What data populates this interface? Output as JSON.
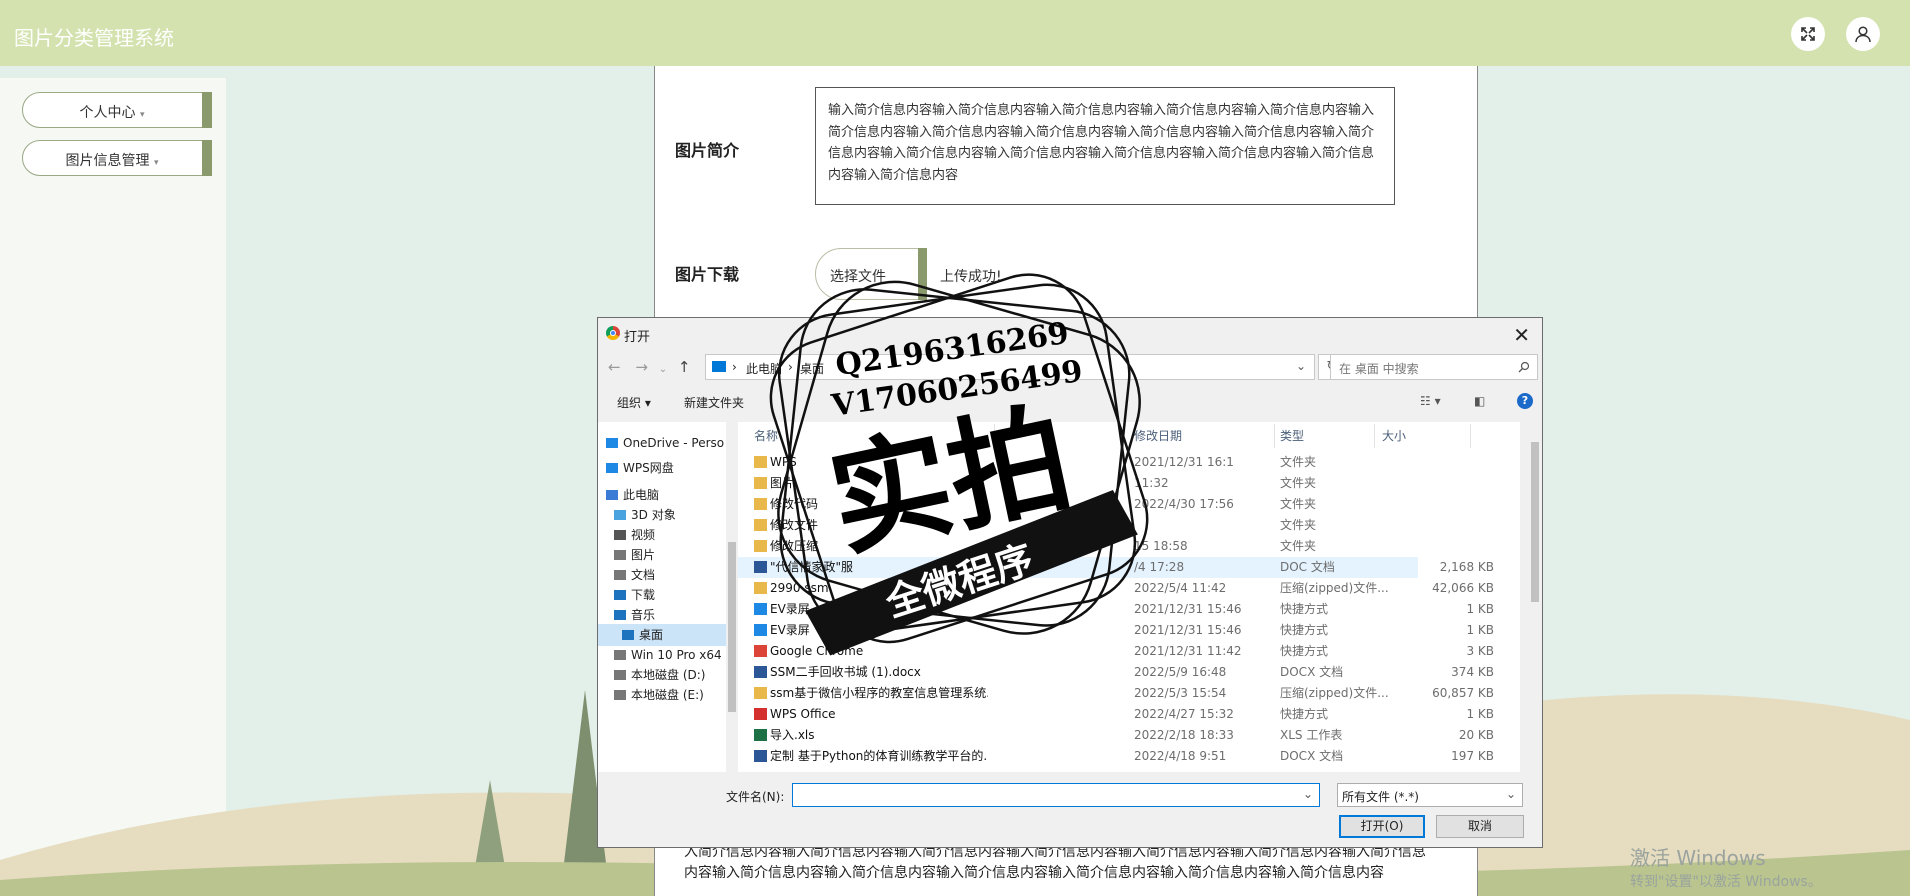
{
  "app": {
    "title": "图片分类管理系统"
  },
  "sidebar": {
    "items": [
      {
        "label": "个人中心"
      },
      {
        "label": "图片信息管理"
      }
    ]
  },
  "form": {
    "intro_label": "图片简介",
    "intro_text": "输入简介信息内容输入简介信息内容输入简介信息内容输入简介信息内容输入简介信息内容输入简介信息内容输入简介信息内容输入简介信息内容输入简介信息内容输入简介信息内容输入简介信息内容输入简介信息内容输入简介信息内容输入简介信息内容输入简介信息内容输入简介信息内容输入简介信息内容",
    "download_label": "图片下载",
    "choose_file": "选择文件",
    "upload_status": "上传成功!",
    "bottom_text": "入简介信息内容输入简介信息内容输入简介信息内容输入简介信息内容输入简介信息内容输入简介信息内容输入简介信息内容输入简介信息内容输入简介信息内容输入简介信息内容输入简介信息内容输入简介信息内容输入简介信息内容"
  },
  "watermark": {
    "line1": "激活 Windows",
    "line2": "转到\"设置\"以激活 Windows。"
  },
  "dialog": {
    "title": "打开",
    "address": {
      "crumbs": [
        "此电脑",
        "桌面"
      ]
    },
    "search_placeholder": "在 桌面 中搜索",
    "toolbar": {
      "organize": "组织 ▾",
      "new_folder": "新建文件夹"
    },
    "nav": [
      {
        "label": "OneDrive - Perso",
        "icon": "cloud-icon",
        "color": "#1e88e5"
      },
      {
        "label": "WPS网盘",
        "icon": "cloud-icon",
        "color": "#1e88e5"
      },
      {
        "label": "此电脑",
        "icon": "computer-icon",
        "color": "#3a7bd5"
      },
      {
        "label": "3D 对象",
        "icon": "cube-icon",
        "color": "#4aa3df"
      },
      {
        "label": "视频",
        "icon": "video-icon",
        "color": "#555555"
      },
      {
        "label": "图片",
        "icon": "picture-icon",
        "color": "#777777"
      },
      {
        "label": "文档",
        "icon": "document-icon",
        "color": "#777777"
      },
      {
        "label": "下载",
        "icon": "download-icon",
        "color": "#1e73be"
      },
      {
        "label": "音乐",
        "icon": "music-icon",
        "color": "#1e73be"
      },
      {
        "label": "桌面",
        "icon": "desktop-icon",
        "color": "#1e73be",
        "selected": true
      },
      {
        "label": "Win 10 Pro x64",
        "icon": "drive-icon",
        "color": "#777777"
      },
      {
        "label": "本地磁盘 (D:)",
        "icon": "drive-icon",
        "color": "#777777"
      },
      {
        "label": "本地磁盘 (E:)",
        "icon": "drive-icon",
        "color": "#777777"
      }
    ],
    "columns": [
      "名称",
      "修改日期",
      "类型",
      "大小"
    ],
    "files": [
      {
        "name": "WPS",
        "date": "2021/12/31 16:1",
        "type": "文件夹",
        "size": "",
        "icon": "folder-icon",
        "color": "#e8b84a"
      },
      {
        "name": "图片",
        "date": "11:32",
        "type": "文件夹",
        "size": "",
        "icon": "folder-icon",
        "color": "#e8b84a"
      },
      {
        "name": "修改代码",
        "date": "2022/4/30 17:56",
        "type": "文件夹",
        "size": "",
        "icon": "folder-icon",
        "color": "#e8b84a"
      },
      {
        "name": "修改文件",
        "date": "",
        "type": "文件夹",
        "size": "",
        "icon": "folder-icon",
        "color": "#e8b84a"
      },
      {
        "name": "修改压缩",
        "date": "15 18:58",
        "type": "文件夹",
        "size": "",
        "icon": "folder-icon",
        "color": "#e8b84a"
      },
      {
        "name": "\"代信情家政\"服",
        "date": "/4 17:28",
        "type": "DOC 文档",
        "size": "2,168 KB",
        "icon": "doc-icon",
        "color": "#2b5797",
        "highlight": true
      },
      {
        "name": "2990 ssm",
        "date": "2022/5/4 11:42",
        "type": "压缩(zipped)文件...",
        "size": "42,066 KB",
        "icon": "zip-icon",
        "color": "#e8b84a"
      },
      {
        "name": "EV录屏",
        "date": "2021/12/31 15:46",
        "type": "快捷方式",
        "size": "1 KB",
        "icon": "shortcut-icon",
        "color": "#1e88e5"
      },
      {
        "name": "EV录屏",
        "date": "2021/12/31 15:46",
        "type": "快捷方式",
        "size": "1 KB",
        "icon": "shortcut-icon",
        "color": "#1e88e5"
      },
      {
        "name": "Google Chrome",
        "date": "2021/12/31 11:42",
        "type": "快捷方式",
        "size": "3 KB",
        "icon": "chrome-icon",
        "color": "#db4437"
      },
      {
        "name": "SSM二手回收书城 (1).docx",
        "date": "2022/5/9 16:48",
        "type": "DOCX 文档",
        "size": "374 KB",
        "icon": "doc-icon",
        "color": "#2b5797"
      },
      {
        "name": "ssm基于微信小程序的教室信息管理系统...",
        "date": "2022/5/3 15:54",
        "type": "压缩(zipped)文件...",
        "size": "60,857 KB",
        "icon": "zip-icon",
        "color": "#e8b84a"
      },
      {
        "name": "WPS Office",
        "date": "2022/4/27 15:32",
        "type": "快捷方式",
        "size": "1 KB",
        "icon": "wps-icon",
        "color": "#d4312e"
      },
      {
        "name": "导入.xls",
        "date": "2022/2/18 18:33",
        "type": "XLS 工作表",
        "size": "20 KB",
        "icon": "xls-icon",
        "color": "#1e7145"
      },
      {
        "name": "定制 基于Python的体育训练教学平台的...",
        "date": "2022/4/18 9:51",
        "type": "DOCX 文档",
        "size": "197 KB",
        "icon": "doc-icon",
        "color": "#2b5797"
      }
    ],
    "filename_label": "文件名(N):",
    "filename_value": "",
    "filetype": "所有文件 (*.*)",
    "open_button": "打开(O)",
    "cancel_button": "取消"
  },
  "stamp": {
    "line1": "Q2196316269",
    "line2": "V17060256499",
    "main": "实拍",
    "banner": "全微程序"
  }
}
